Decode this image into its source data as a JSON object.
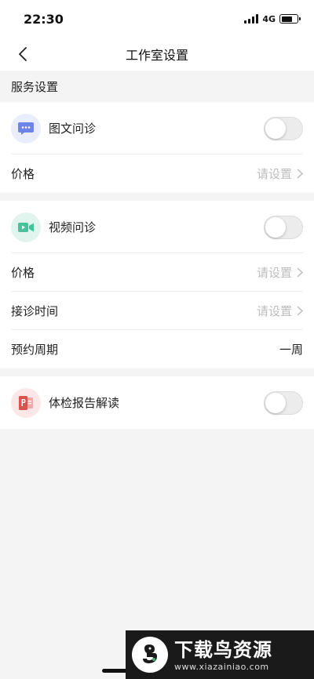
{
  "status_bar": {
    "time": "22:30",
    "network": "4G",
    "battery_level": 0.7
  },
  "nav": {
    "title": "工作室设置",
    "back_icon": "chevron-left-icon"
  },
  "section_title": "服务设置",
  "services": {
    "text_consult": {
      "label": "图文问诊",
      "icon": "chat-bubble-icon",
      "icon_color": "#6f84e8",
      "icon_bg": "#eaeefc",
      "enabled": false,
      "price_label": "价格",
      "price_value": "请设置"
    },
    "video_consult": {
      "label": "视频问诊",
      "icon": "video-camera-icon",
      "icon_color": "#45c39b",
      "icon_bg": "#e1f5ee",
      "enabled": false,
      "price_label": "价格",
      "price_value": "请设置",
      "time_label": "接诊时间",
      "time_value": "请设置",
      "cycle_label": "预约周期",
      "cycle_value": "一周"
    },
    "report_read": {
      "label": "体检报告解读",
      "icon": "report-document-icon",
      "icon_color": "#d9534f",
      "icon_bg": "#fbe7e7",
      "enabled": false
    }
  },
  "watermark": {
    "title": "下载鸟资源",
    "url": "www.xiazainiao.com"
  }
}
